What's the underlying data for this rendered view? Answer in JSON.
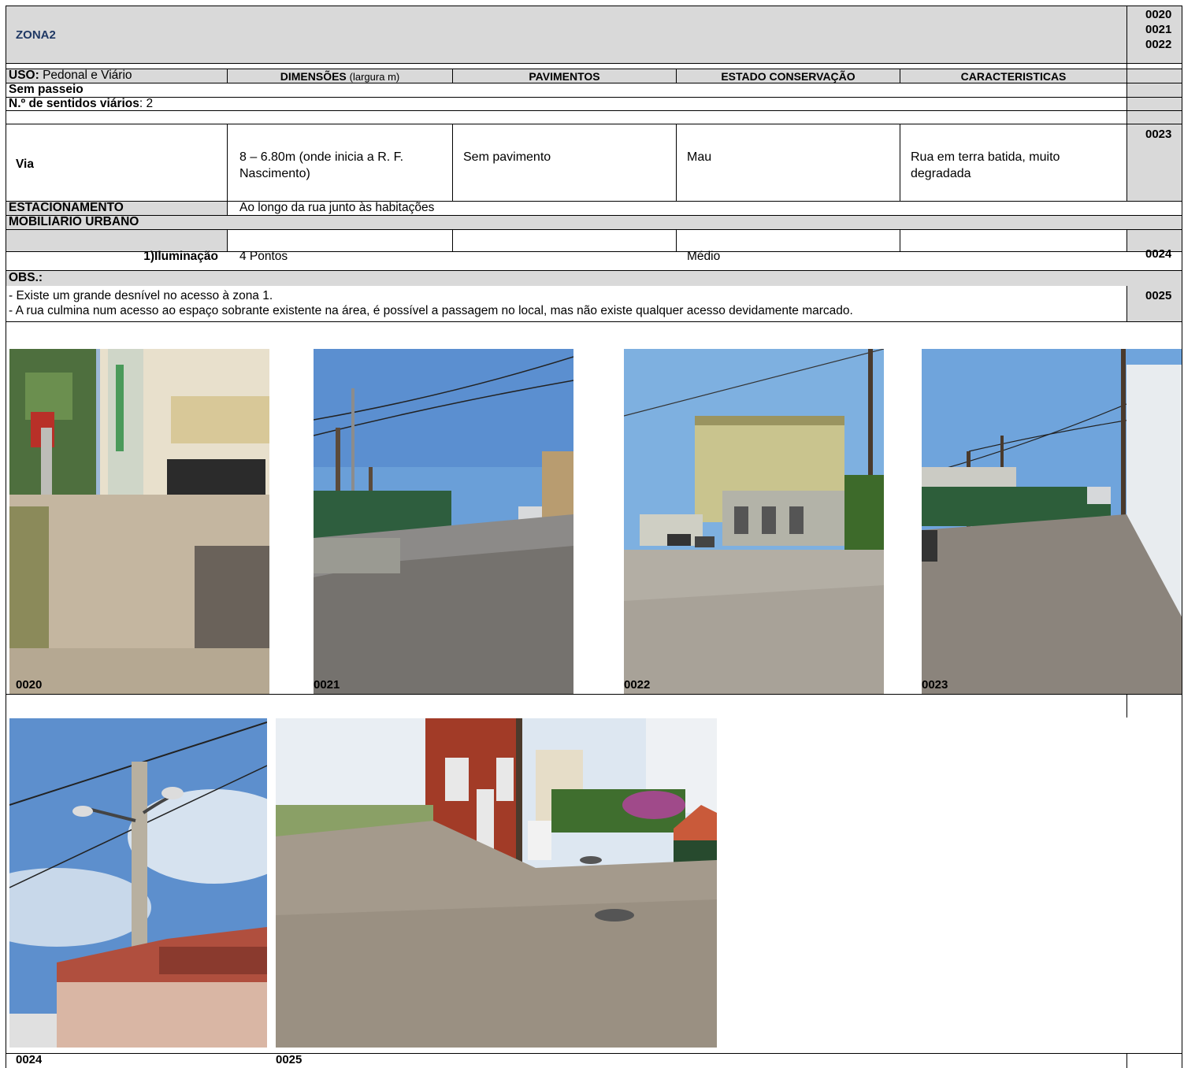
{
  "header": {
    "title": "ZONA2",
    "refs": [
      "0020",
      "0021",
      "0022"
    ]
  },
  "columns": {
    "uso_label": "USO:",
    "uso_value": "Pedonal e Viário",
    "dimensoes_label": "DIMENSÕES",
    "dimensoes_unit": "(largura m)",
    "pavimentos": "PAVIMENTOS",
    "estado": "ESTADO CONSERVAÇÃO",
    "caracteristicas": "CARACTERISTICAS"
  },
  "sem_passeio": "Sem passeio",
  "sentidos": {
    "label": "N.º de sentidos viários",
    "value": ": 2"
  },
  "via": {
    "label": "Via",
    "dimensoes": "8 – 6.80m (onde inicia a R. F. Nascimento)",
    "pavimento": "Sem pavimento",
    "estado": "Mau",
    "caracteristicas": "Rua em terra batida, muito degradada",
    "ref": "0023"
  },
  "estacionamento": {
    "label": "ESTACIONAMENTO",
    "value": "Ao longo da rua junto às habitações"
  },
  "mobiliario": "MOBILIÁRIO URBANO",
  "iluminacao": {
    "label": "1)Iluminação",
    "value": "4 Pontos",
    "estado": "Médio",
    "ref": "0024"
  },
  "obs": {
    "label": "OBS.:",
    "lines": [
      "- Existe um grande desnível no acesso à zona 1.",
      "- A rua culmina num acesso ao espaço sobrante existente na área, é possível a passagem no local, mas não existe qualquer acesso devidamente marcado."
    ],
    "ref": "0025"
  },
  "photos": {
    "row1": [
      "0020",
      "0021",
      "0022",
      "0023"
    ],
    "row2": [
      "0024",
      "0025"
    ]
  }
}
